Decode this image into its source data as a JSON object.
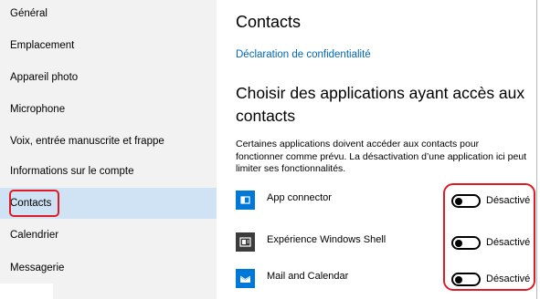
{
  "sidebar": {
    "items": [
      {
        "label": "Général"
      },
      {
        "label": "Emplacement"
      },
      {
        "label": "Appareil photo"
      },
      {
        "label": "Microphone"
      },
      {
        "label": "Voix, entrée manuscrite et frappe"
      },
      {
        "label": "Informations sur le compte"
      },
      {
        "label": "Contacts",
        "selected": true
      },
      {
        "label": "Calendrier"
      },
      {
        "label": "Messagerie"
      }
    ]
  },
  "main": {
    "title": "Contacts",
    "privacy_link": "Déclaration de confidentialité",
    "section_title": "Choisir des applications ayant accès aux contacts",
    "description": "Certaines applications doivent accéder aux contacts pour fonctionner comme prévu. La désactivation d’une application ici peut limiter ses fonctionnalités.",
    "apps": [
      {
        "name": "App connector",
        "icon": "app-connector-icon",
        "icon_bg": "#0078d7",
        "state": "Désactivé"
      },
      {
        "name": "Expérience Windows Shell",
        "icon": "windows-shell-icon",
        "icon_bg": "#3c3c3c",
        "state": "Désactivé"
      },
      {
        "name": "Mail and Calendar",
        "icon": "mail-icon",
        "icon_bg": "#0078d7",
        "state": "Désactivé"
      }
    ]
  },
  "colors": {
    "accent": "#0078d7",
    "link": "#0067b8",
    "selected_bg": "#cfe3f5",
    "highlight_red": "#e01b24"
  }
}
